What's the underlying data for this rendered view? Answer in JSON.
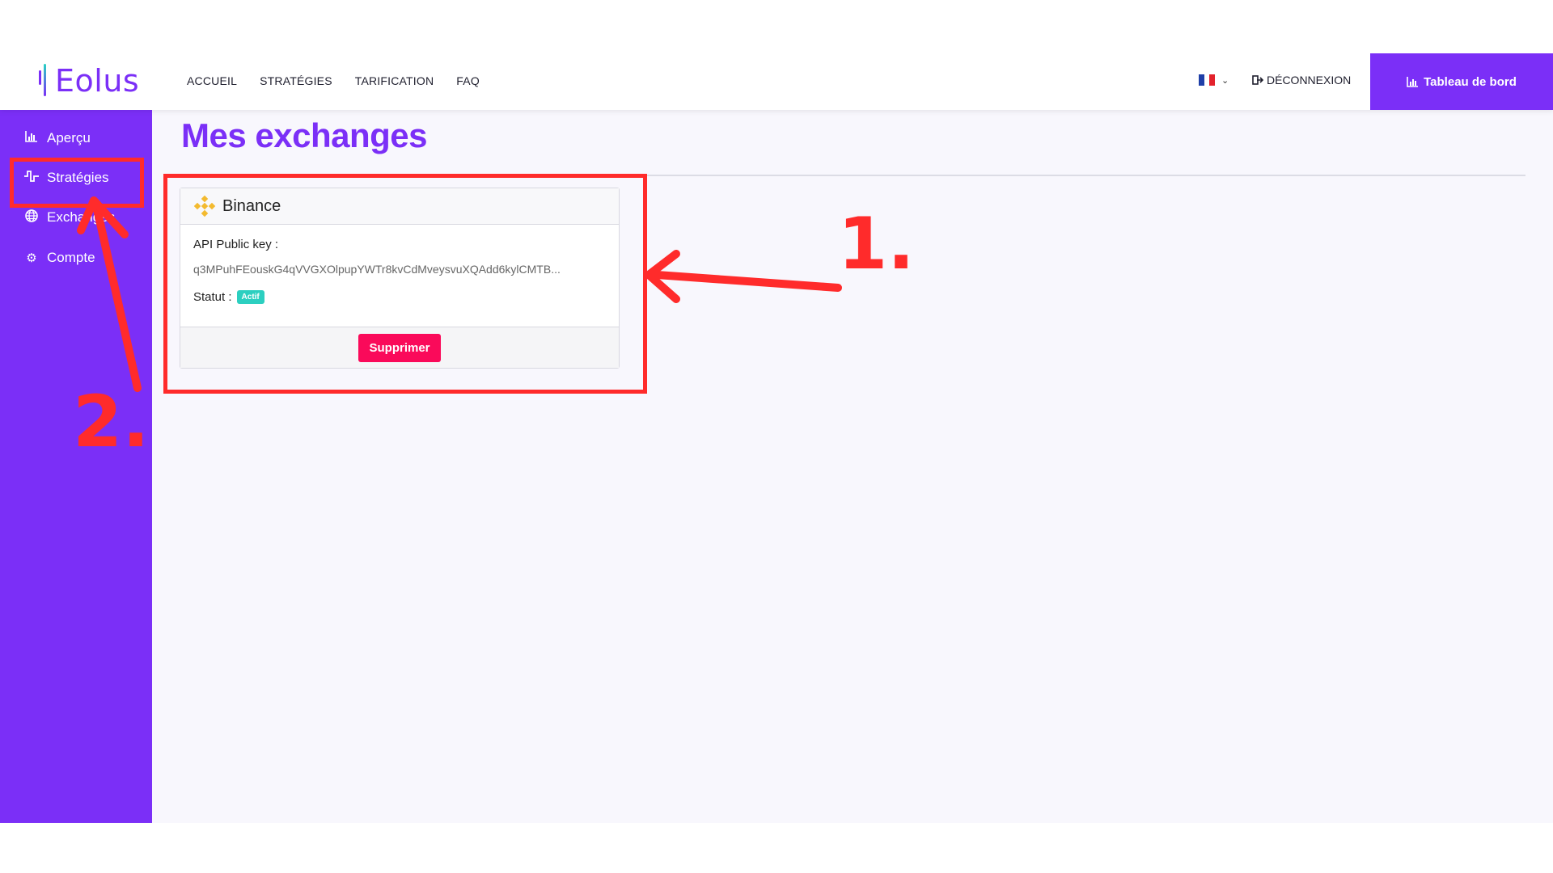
{
  "app": {
    "logo_text": "Eolus",
    "nav": [
      "ACCUEIL",
      "STRATÉGIES",
      "TARIFICATION",
      "FAQ"
    ],
    "language": "FR",
    "logout_label": "DÉCONNEXION",
    "dashboard_label": "Tableau de bord"
  },
  "sidebar": {
    "items": [
      {
        "label": "Aperçu",
        "icon": "chart-bar-icon"
      },
      {
        "label": "Stratégies",
        "icon": "waveform-icon"
      },
      {
        "label": "Exchanges",
        "icon": "globe-icon"
      },
      {
        "label": "Compte",
        "icon": "gear-icon"
      }
    ]
  },
  "main": {
    "title": "Mes exchanges",
    "card": {
      "exchange_name": "Binance",
      "api_label": "API Public key :",
      "api_key": "q3MPuhFEouskG4qVVGXOlpupYWTr8kvCdMveysvuXQAdd6kylCMTB...",
      "status_label": "Statut :",
      "status_value": "Actif",
      "delete_label": "Supprimer"
    }
  },
  "annotations": {
    "step1": "1.",
    "step2": "2."
  },
  "colors": {
    "brand": "#7b2ff7",
    "danger": "#fa0a5a",
    "success": "#2ccfc0",
    "annotation": "#ff2b2b"
  }
}
